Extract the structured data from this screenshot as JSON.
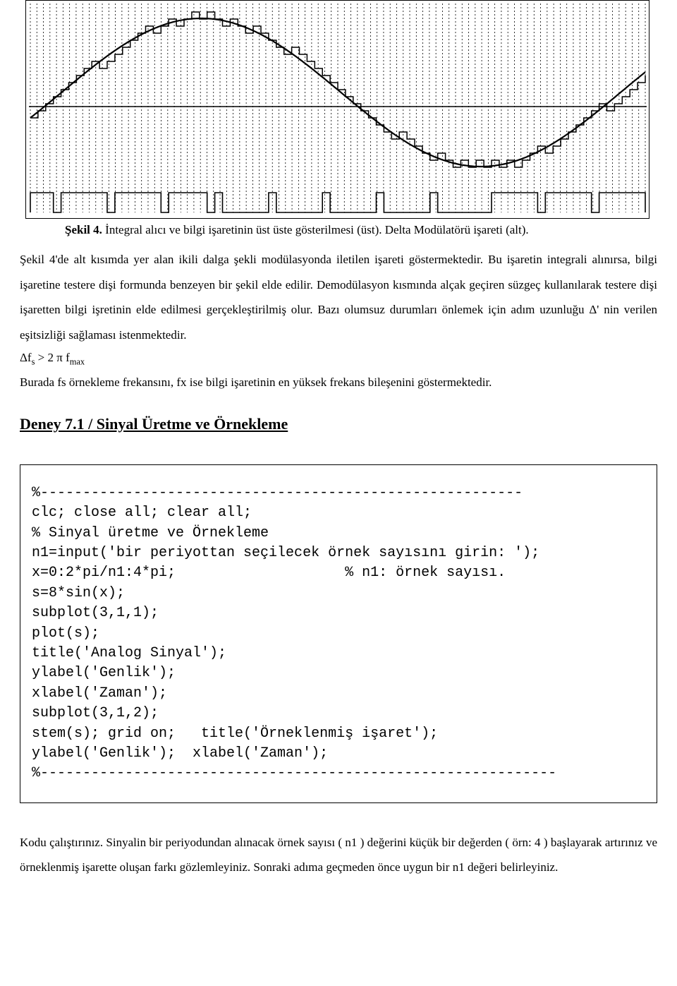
{
  "figure": {
    "caption_bold": "Şekil 4.",
    "caption_text": " İntegral alıcı ve bilgi işaretinin üst üste gösterilmesi (üst). Delta Modülatörü işareti (alt)."
  },
  "paragraph1": "Şekil 4'de alt kısımda yer alan ikili dalga şekli modülasyonda iletilen işareti göstermektedir. Bu işaretin integrali alınırsa, bilgi işaretine testere dişi formunda benzeyen bir şekil elde edilir. Demodülasyon kısmında alçak geçiren süzgeç kullanılarak testere dişi işaretten bilgi işretinin elde edilmesi gerçekleştirilmiş olur. Bazı olumsuz durumları önlemek için adım uzunluğu Δ' nin verilen eşitsizliği sağlaması istenmektedir.",
  "formula_text": "Δfₛ > 2 π f",
  "formula_sub": "max",
  "formula_prefix_sub": "s",
  "paragraph2": "Burada fs örnekleme frekansını, fx ise bilgi işaretinin en yüksek frekans bileşenini göstermektedir.",
  "section_heading": "Deney 7.1 / Sinyal Üretme ve Örnekleme",
  "code_lines": [
    "%---------------------------------------------------------",
    "clc; close all; clear all;",
    "% Sinyal üretme ve Örnekleme",
    "n1=input('bir periyottan seçilecek örnek sayısını girin: ');",
    "x=0:2*pi/n1:4*pi;                    % n1: örnek sayısı.",
    "s=8*sin(x);",
    "subplot(3,1,1);",
    "plot(s);",
    "title('Analog Sinyal');",
    "ylabel('Genlik');",
    "xlabel('Zaman');",
    "subplot(3,1,2);",
    "stem(s); grid on;   title('Örneklenmiş işaret');",
    "ylabel('Genlik');  xlabel('Zaman');",
    "%-------------------------------------------------------------"
  ],
  "closing_paragraph": "Kodu çalıştırınız. Sinyalin bir periyodundan alınacak örnek sayısı ( n1 ) değerini küçük bir değerden ( örn: 4 ) başlayarak artırınız ve örneklenmiş işarette oluşan farkı gözlemleyiniz. Sonraki adıma geçmeden önce uygun bir n1 değeri belirleyiniz."
}
